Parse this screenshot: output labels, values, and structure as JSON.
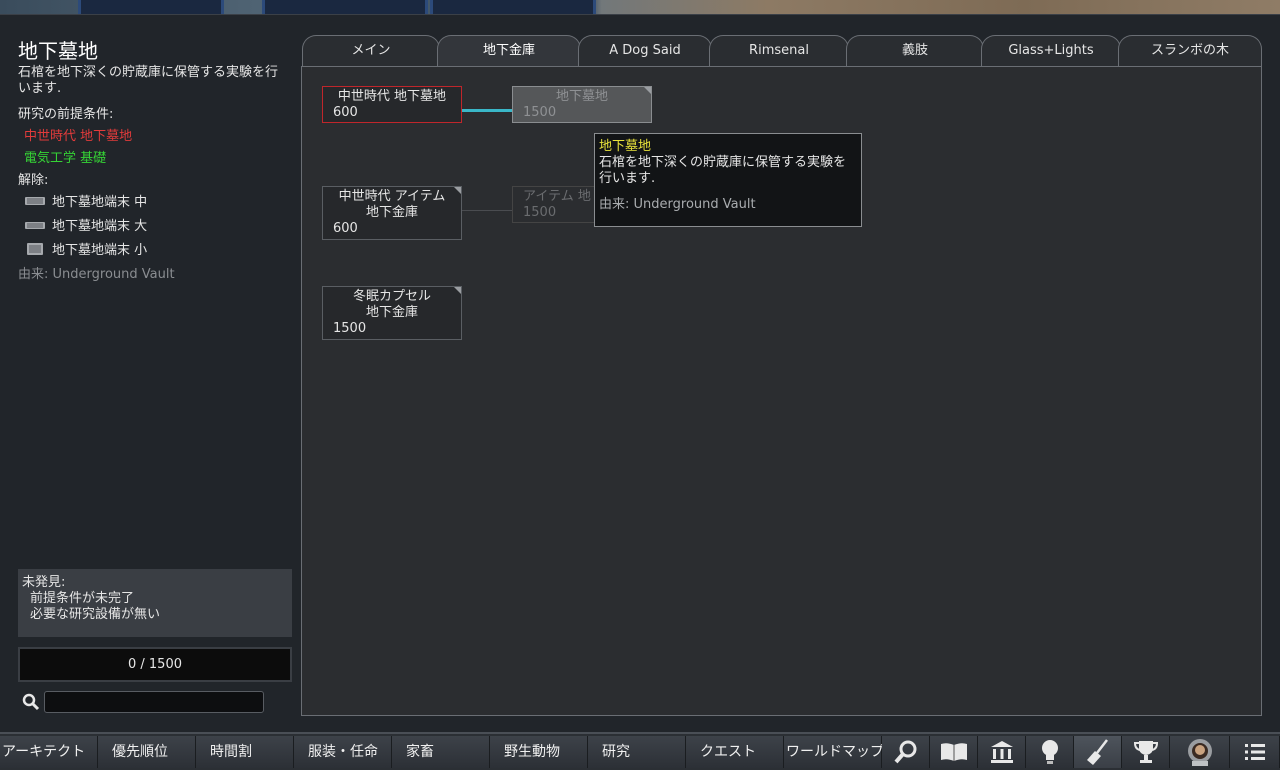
{
  "project": {
    "title": "地下墓地",
    "description": "石棺を地下深くの貯蔵庫に保管する実験を行います.",
    "prereq_label": "研究の前提条件:",
    "prerequisites": [
      {
        "label": "中世時代 地下墓地",
        "status": "incomplete",
        "color": "#e23b3b"
      },
      {
        "label": "電気工学 基礎",
        "status": "complete",
        "color": "#35d335"
      }
    ],
    "unlocks_label": "解除:",
    "unlocks": [
      {
        "label": "地下墓地端末 中",
        "icon": "sarcophagus-icon"
      },
      {
        "label": "地下墓地端末 大",
        "icon": "sarcophagus-icon"
      },
      {
        "label": "地下墓地端末 小",
        "icon": "sarcophagus-icon"
      }
    ],
    "source": "由来:  Underground Vault",
    "notes": {
      "title": "未発見:",
      "line1": "前提条件が未完了",
      "line2": "必要な研究設備が無い"
    },
    "progress": {
      "text": "0 / 1500",
      "current": 0,
      "total": 1500
    },
    "search_placeholder": ""
  },
  "tabs": [
    {
      "label": "メイン",
      "active": false
    },
    {
      "label": "地下金庫",
      "active": true
    },
    {
      "label": "A Dog Said",
      "active": false
    },
    {
      "label": "Rimsenal",
      "active": false
    },
    {
      "label": "義肢",
      "active": false
    },
    {
      "label": "Glass+Lights",
      "active": false
    },
    {
      "label": "スランボの木",
      "active": false
    }
  ],
  "tree": {
    "nodes": [
      {
        "title": "中世時代 地下墓地",
        "cost": "600",
        "state": "selected"
      },
      {
        "title": "地下墓地",
        "cost": "1500",
        "state": "locked"
      },
      {
        "title1": "中世時代 アイテム",
        "title2": "地下金庫",
        "cost": "600",
        "state": "available"
      },
      {
        "title": "アイテム 地",
        "cost": "1500",
        "state": "dim"
      },
      {
        "title1": "冬眠カプセル",
        "title2": "地下金庫",
        "cost": "1500",
        "state": "available"
      }
    ]
  },
  "tooltip": {
    "title": "地下墓地",
    "description": "石棺を地下深くの貯蔵庫に保管する実験を行います.",
    "source": "由来: Underground Vault",
    "title_color": "#e8e23b"
  },
  "bottom_bar": {
    "buttons": [
      "アーキテクト",
      "優先順位",
      "時間割",
      "服装・任命",
      "家畜",
      "野生動物",
      "研究",
      "クエスト",
      "ワールドマップ"
    ],
    "icons": [
      "search-icon",
      "book-icon",
      "history-icon",
      "lightbulb-icon",
      "broom-icon",
      "trophy-icon",
      "astronaut-icon",
      "menu-icon"
    ]
  }
}
